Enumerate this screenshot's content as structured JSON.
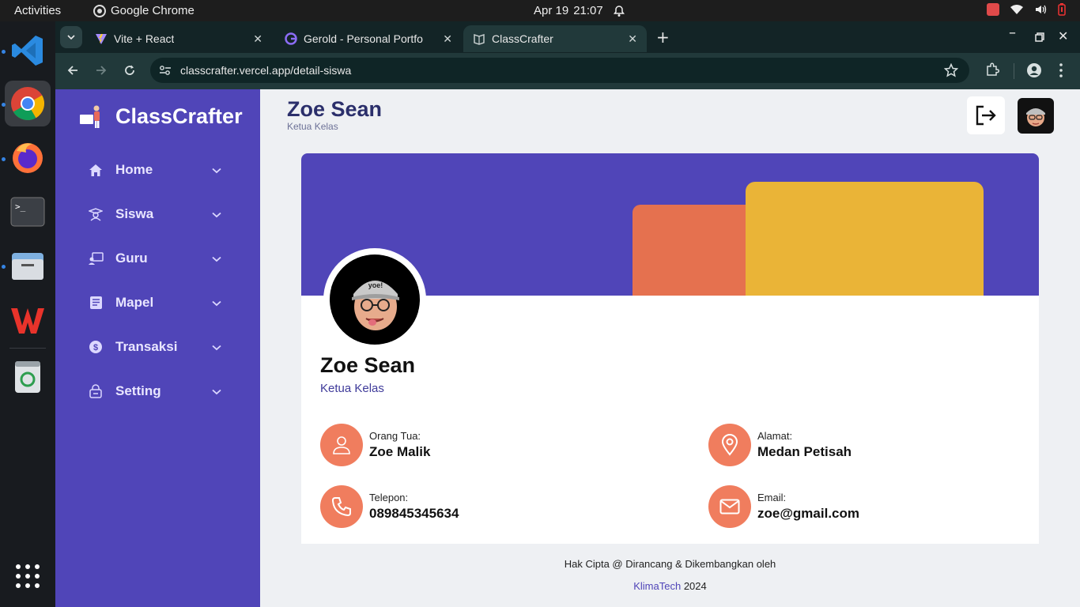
{
  "os": {
    "activities": "Activities",
    "app_name": "Google Chrome",
    "date": "Apr 19",
    "time": "21:07"
  },
  "browser": {
    "tabs": [
      {
        "title": "Vite + React",
        "active": false
      },
      {
        "title": "Gerold - Personal Portfo",
        "active": false
      },
      {
        "title": "ClassCrafter",
        "active": true
      }
    ],
    "url": "classcrafter.vercel.app/detail-siswa"
  },
  "app": {
    "brand": "ClassCrafter",
    "nav": [
      {
        "label": "Home",
        "icon": "home-icon"
      },
      {
        "label": "Siswa",
        "icon": "student-icon"
      },
      {
        "label": "Guru",
        "icon": "teacher-icon"
      },
      {
        "label": "Mapel",
        "icon": "book-icon"
      },
      {
        "label": "Transaksi",
        "icon": "dollar-icon"
      },
      {
        "label": "Setting",
        "icon": "lock-icon"
      }
    ],
    "header": {
      "title": "Zoe Sean",
      "subtitle": "Ketua Kelas"
    },
    "profile": {
      "name": "Zoe Sean",
      "role": "Ketua Kelas",
      "fields": [
        {
          "label": "Orang Tua:",
          "value": "Zoe Malik",
          "icon": "user-icon"
        },
        {
          "label": "Alamat:",
          "value": "Medan Petisah",
          "icon": "location-icon"
        },
        {
          "label": "Telepon:",
          "value": "089845345634",
          "icon": "phone-icon"
        },
        {
          "label": "Email:",
          "value": "zoe@gmail.com",
          "icon": "mail-icon"
        }
      ]
    },
    "footer": {
      "line1": "Hak Cipta @ Dirancang & Dikembangkan oleh",
      "brand": "KlimaTech",
      "year": "2024"
    }
  },
  "colors": {
    "primary": "#5045b8",
    "orange": "#e5714f",
    "yellow": "#eab437",
    "icon_circle": "#f07d5e"
  }
}
